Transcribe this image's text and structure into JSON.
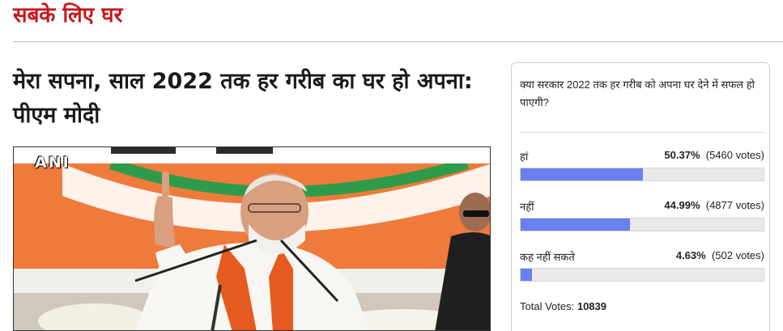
{
  "section": {
    "title": "सबके लिए घर"
  },
  "article": {
    "headline": "मेरा सपना, साल 2022 तक हर गरीब का घर हो अपना: पीएम मोदी",
    "image": {
      "watermark": "ANI",
      "depicts": "speaker-at-rally-photo"
    }
  },
  "poll": {
    "question": "क्या सरकार 2022 तक हर गरीब को अपना घर देने में सफल हो पाएगी?",
    "options": [
      {
        "label": "हां",
        "percent": "50.37%",
        "votes": "(5460 votes)",
        "fraction": 0.5037
      },
      {
        "label": "नहीं",
        "percent": "44.99%",
        "votes": "(4877 votes)",
        "fraction": 0.4499
      },
      {
        "label": "कह नहीं सकते",
        "percent": "4.63%",
        "votes": "(502 votes)",
        "fraction": 0.0463
      }
    ],
    "total_label": "Total Votes:",
    "total_value": "10839",
    "bar_color": "#6a7ff0"
  },
  "colors": {
    "accent": "#c8161d",
    "headline": "#1a1a1a"
  }
}
